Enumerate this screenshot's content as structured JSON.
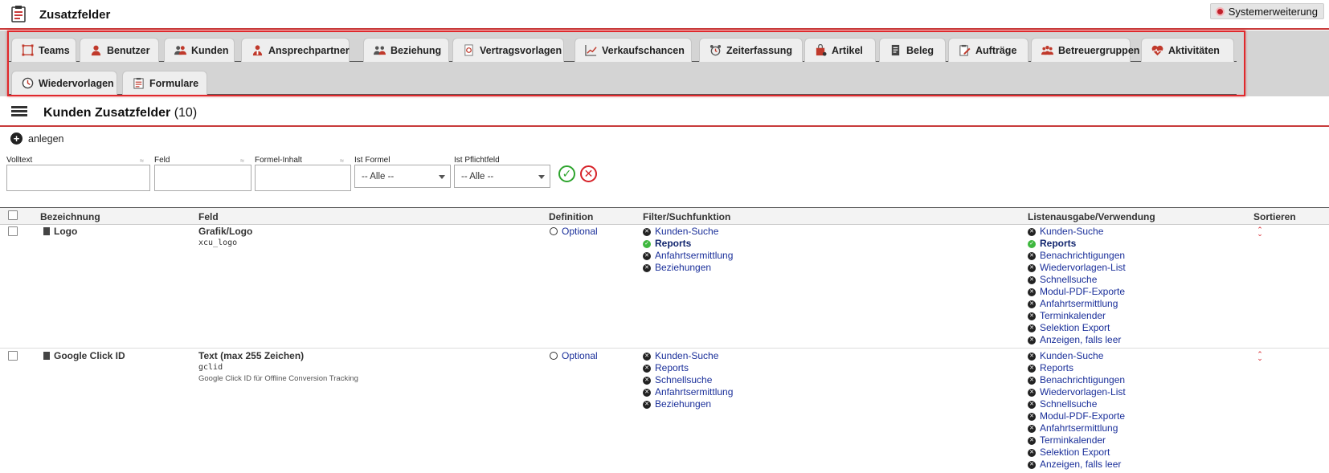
{
  "header": {
    "title": "Zusatzfelder",
    "system_button": "Systemerweiterung"
  },
  "tabs_row1": [
    {
      "label": "Teams",
      "icon": "teams-icon"
    },
    {
      "label": "Benutzer",
      "icon": "user-icon"
    },
    {
      "label": "Kunden",
      "icon": "customers-icon"
    },
    {
      "label": "Ansprechpartner",
      "icon": "contact-icon"
    },
    {
      "label": "Beziehung",
      "icon": "relation-icon"
    },
    {
      "label": "Vertragsvorlagen",
      "icon": "contract-template-icon"
    },
    {
      "label": "Verkaufschancen",
      "icon": "chart-line-icon"
    },
    {
      "label": "Zeiterfassung",
      "icon": "alarm-clock-icon"
    },
    {
      "label": "Artikel",
      "icon": "shopping-bag-icon"
    },
    {
      "label": "Beleg",
      "icon": "document-icon"
    },
    {
      "label": "Aufträge",
      "icon": "clipboard-edit-icon"
    },
    {
      "label": "Betreuergruppen",
      "icon": "group-icon"
    },
    {
      "label": "Aktivitäten",
      "icon": "heart-pulse-icon"
    }
  ],
  "tabs_row2": [
    {
      "label": "Wiedervorlagen",
      "icon": "clock-icon"
    },
    {
      "label": "Formulare",
      "icon": "form-icon"
    }
  ],
  "section": {
    "title": "Kunden Zusatzfelder",
    "count": "(10)",
    "add_label": "anlegen"
  },
  "filters": {
    "volltext": "Volltext",
    "feld": "Feld",
    "formel_inhalt": "Formel-Inhalt",
    "ist_formel": "Ist Formel",
    "ist_formel_value": "-- Alle --",
    "ist_pflichtfeld": "Ist Pflichtfeld",
    "ist_pflichtfeld_value": "-- Alle --"
  },
  "table": {
    "columns": [
      "Bezeichnung",
      "Feld",
      "Definition",
      "Filter/Suchfunktion",
      "Listenausgabe/Verwendung",
      "Sortieren"
    ],
    "rows": [
      {
        "name": "Logo",
        "field_type": "Grafik/Logo",
        "field_key": "xcu_logo",
        "field_desc": "",
        "definition": "Optional",
        "filter": [
          {
            "label": "Kunden-Suche",
            "state": "off"
          },
          {
            "label": "Reports",
            "state": "on"
          },
          {
            "label": "Anfahrtsermittlung",
            "state": "off"
          },
          {
            "label": "Beziehungen",
            "state": "off"
          }
        ],
        "listing": [
          {
            "label": "Kunden-Suche",
            "state": "off"
          },
          {
            "label": "Reports",
            "state": "on"
          },
          {
            "label": "Benachrichtigungen",
            "state": "off"
          },
          {
            "label": "Wiedervorlagen-List",
            "state": "off"
          },
          {
            "label": "Schnellsuche",
            "state": "off"
          },
          {
            "label": "Modul-PDF-Exporte",
            "state": "off"
          },
          {
            "label": "Anfahrtsermittlung",
            "state": "off"
          },
          {
            "label": "Terminkalender",
            "state": "off"
          },
          {
            "label": "Selektion Export",
            "state": "off"
          },
          {
            "label": "Anzeigen, falls leer",
            "state": "off"
          }
        ]
      },
      {
        "name": "Google Click ID",
        "field_type": "Text (max 255 Zeichen)",
        "field_key": "gclid",
        "field_desc": "Google Click ID für Offline Conversion Tracking",
        "definition": "Optional",
        "filter": [
          {
            "label": "Kunden-Suche",
            "state": "off"
          },
          {
            "label": "Reports",
            "state": "off"
          },
          {
            "label": "Schnellsuche",
            "state": "off"
          },
          {
            "label": "Anfahrtsermittlung",
            "state": "off"
          },
          {
            "label": "Beziehungen",
            "state": "off"
          }
        ],
        "listing": [
          {
            "label": "Kunden-Suche",
            "state": "off"
          },
          {
            "label": "Reports",
            "state": "off"
          },
          {
            "label": "Benachrichtigungen",
            "state": "off"
          },
          {
            "label": "Wiedervorlagen-List",
            "state": "off"
          },
          {
            "label": "Schnellsuche",
            "state": "off"
          },
          {
            "label": "Modul-PDF-Exporte",
            "state": "off"
          },
          {
            "label": "Anfahrtsermittlung",
            "state": "off"
          },
          {
            "label": "Terminkalender",
            "state": "off"
          },
          {
            "label": "Selektion Export",
            "state": "off"
          },
          {
            "label": "Anzeigen, falls leer",
            "state": "off"
          }
        ]
      }
    ]
  },
  "colors": {
    "accent_red": "#c83a3a",
    "link_blue": "#1a2f9a",
    "ok_green": "#3fb83f",
    "tab_bg": "#d4d4d4"
  }
}
